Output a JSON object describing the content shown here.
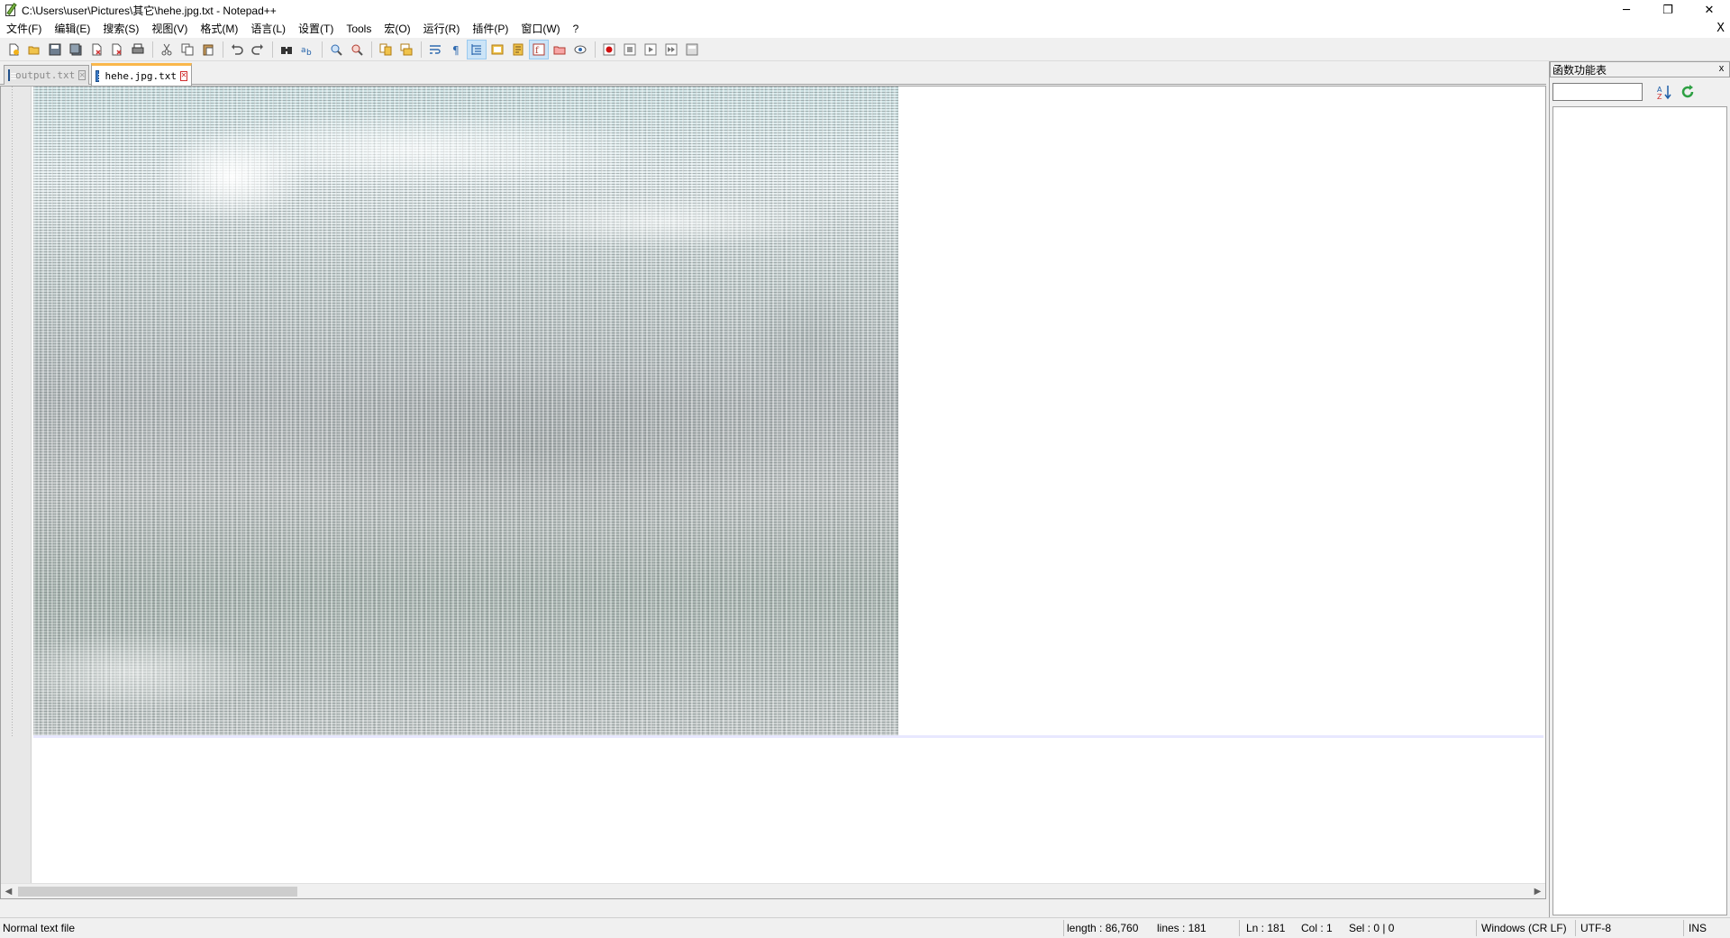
{
  "window": {
    "title": "C:\\Users\\user\\Pictures\\其它\\hehe.jpg.txt - Notepad++",
    "minimize": "─",
    "restore": "❐",
    "close": "✕"
  },
  "menu": {
    "items": [
      "文件(F)",
      "编辑(E)",
      "搜索(S)",
      "视图(V)",
      "格式(M)",
      "语言(L)",
      "设置(T)",
      "Tools",
      "宏(O)",
      "运行(R)",
      "插件(P)",
      "窗口(W)",
      "?"
    ],
    "close": "X"
  },
  "toolbar": {
    "buttons": [
      "new-file-icon",
      "open-file-icon",
      "save-icon",
      "save-all-icon",
      "close-icon",
      "close-all-icon",
      "print-icon",
      "cut-icon",
      "copy-icon",
      "paste-icon",
      "undo-icon",
      "redo-icon",
      "find-icon",
      "replace-icon",
      "zoom-in-icon",
      "zoom-out-icon",
      "sync-vertical-icon",
      "sync-horizontal-icon",
      "word-wrap-icon",
      "show-all-chars-icon",
      "indent-guide-icon",
      "user-language-icon",
      "document-map-icon",
      "function-list-icon",
      "folder-as-workspace-icon",
      "monitoring-icon",
      "record-macro-icon",
      "stop-record-icon",
      "play-macro-icon",
      "run-macro-multiple-icon",
      "save-macro-icon"
    ]
  },
  "tabs": [
    {
      "label": "output.txt",
      "active": false
    },
    {
      "label": "hehe.jpg.txt",
      "active": true
    }
  ],
  "function_list": {
    "title": "函数功能表",
    "close": "x",
    "search_value": ""
  },
  "status": {
    "file_type": "Normal text file",
    "length": "length : 86,760",
    "lines": "lines : 181",
    "ln": "Ln : 181",
    "col": "Col : 1",
    "sel": "Sel : 0 | 0",
    "eol": "Windows (CR LF)",
    "encoding": "UTF-8",
    "mode": "INS"
  },
  "colors": {
    "tab_accent": "#fab74b",
    "tab_close": "#d03030",
    "current_line": "#e8e8ff"
  }
}
